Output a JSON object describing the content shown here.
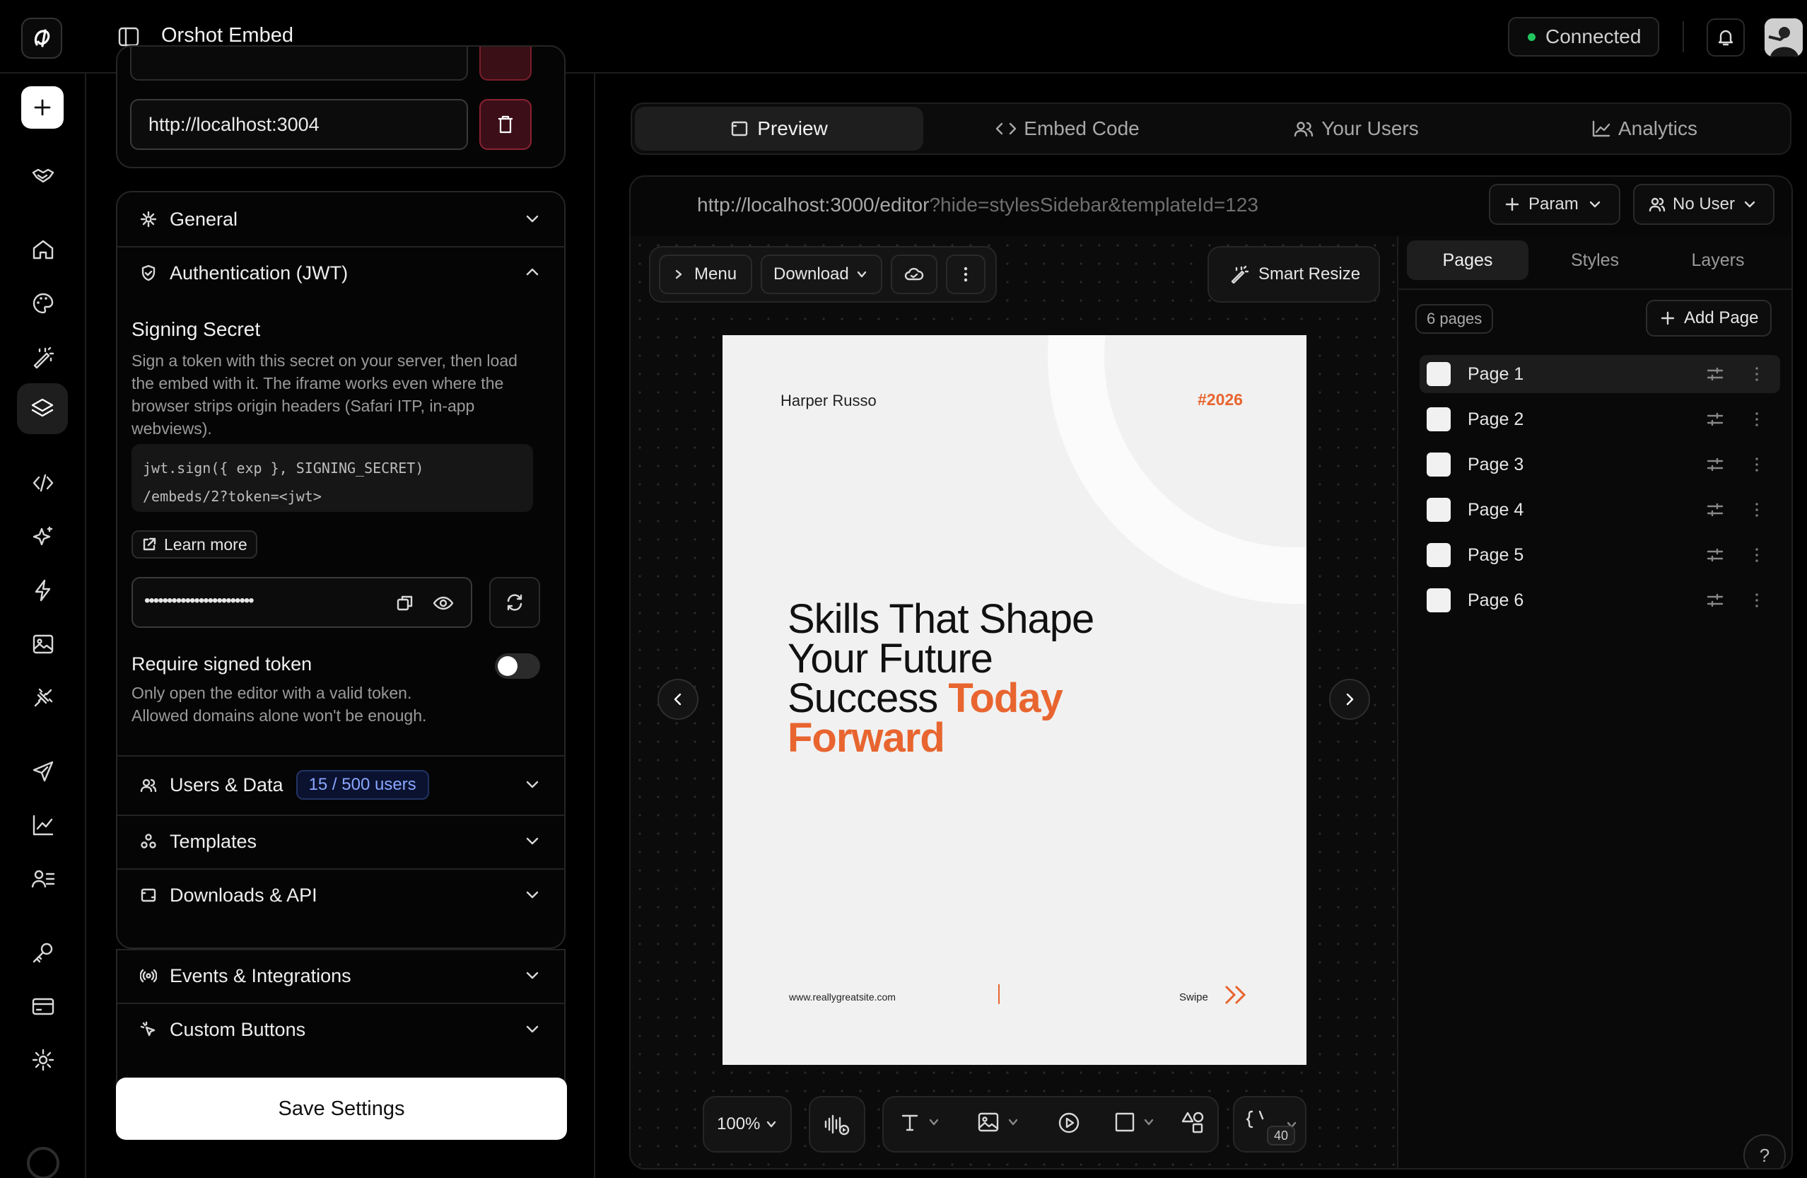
{
  "app": {
    "title": "Orshot Embed",
    "status": "Connected"
  },
  "settings": {
    "origin_value": "http://localhost:3004",
    "sections": {
      "general": "General",
      "auth": "Authentication (JWT)",
      "users": "Users & Data",
      "users_badge": "15 / 500 users",
      "templates": "Templates",
      "downloads": "Downloads & API",
      "events": "Events & Integrations",
      "custom_buttons": "Custom Buttons"
    },
    "auth": {
      "signing_title": "Signing Secret",
      "signing_desc": "Sign a token with this secret on your server, then load the embed with it. The iframe works even where the browser strips origin headers (Safari ITP, in-app webviews).",
      "code_line1": "jwt.sign({ exp }, SIGNING_SECRET)",
      "code_line2": "/embeds/2?token=<jwt>",
      "learn_more": "Learn more",
      "secret_masked": "••••••••••••••••••••••••",
      "require_title": "Require signed token",
      "require_desc": "Only open the editor with a valid token. Allowed domains alone won't be enough."
    },
    "save_label": "Save Settings"
  },
  "tabs": [
    {
      "label": "Preview",
      "icon": "preview-icon"
    },
    {
      "label": "Embed Code",
      "icon": "code-icon"
    },
    {
      "label": "Your Users",
      "icon": "users-icon"
    },
    {
      "label": "Analytics",
      "icon": "chart-icon"
    }
  ],
  "preview": {
    "url_base": "http://localhost:3000/editor",
    "url_query": "?hide=stylesSidebar&templateId=123",
    "param_label": "Param",
    "user_label": "No User",
    "menu_label": "Menu",
    "download_label": "Download",
    "smart_resize": "Smart Resize",
    "zoom": "100%",
    "var_count": "40"
  },
  "design": {
    "author": "Harper Russo",
    "tag": "#2026",
    "line1": "Skills That Shape",
    "line2": "Your Future",
    "line3a": "Success ",
    "line3b": "Today",
    "line4": "Forward",
    "website": "www.reallygreatsite.com",
    "swipe": "Swipe",
    "accent": "#e8652f"
  },
  "sidebar": {
    "tabs": [
      "Pages",
      "Styles",
      "Layers"
    ],
    "count": "6 pages",
    "add_page": "Add Page",
    "pages": [
      "Page 1",
      "Page 2",
      "Page 3",
      "Page 4",
      "Page 5",
      "Page 6"
    ]
  },
  "help": "?"
}
